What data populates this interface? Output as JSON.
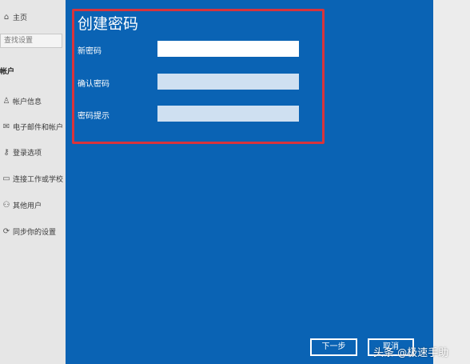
{
  "sidebar": {
    "home_label": "主页",
    "search_placeholder": "查找设置",
    "section_title": "帐户",
    "items": [
      {
        "label": "帐户信息",
        "icon": "person-icon"
      },
      {
        "label": "电子邮件和帐户",
        "icon": "mail-icon"
      },
      {
        "label": "登录选项",
        "icon": "key-icon"
      },
      {
        "label": "连接工作或学校",
        "icon": "briefcase-icon"
      },
      {
        "label": "其他用户",
        "icon": "people-icon"
      },
      {
        "label": "同步你的设置",
        "icon": "sync-icon"
      }
    ]
  },
  "dialog": {
    "title": "创建密码",
    "new_password_label": "新密码",
    "confirm_password_label": "确认密码",
    "hint_label": "密码提示",
    "new_password_value": "",
    "confirm_password_value": "",
    "hint_value": "",
    "next_button": "下一步",
    "cancel_button": "取消"
  },
  "watermark": {
    "source": "头条",
    "at": "@",
    "author": "极速手助"
  },
  "colors": {
    "dialog_bg": "#0a63b4",
    "highlight_border": "#d8343c",
    "inactive_field": "#cfe0f1"
  }
}
